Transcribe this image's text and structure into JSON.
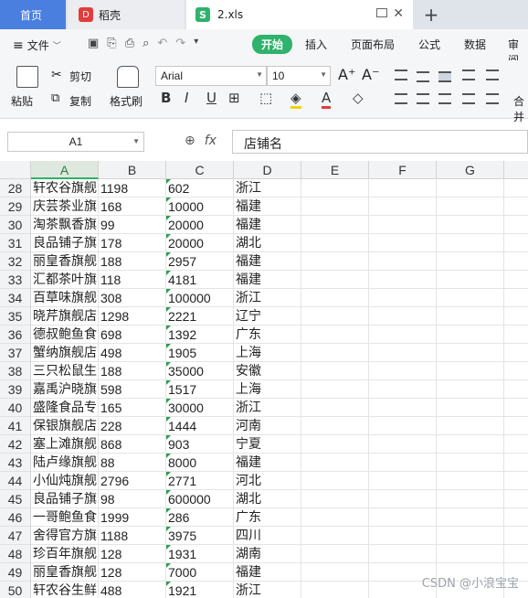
{
  "tabs": {
    "home": "首页",
    "doc": "稻壳",
    "file": "2.xls"
  },
  "menu": {
    "file": "文件",
    "items": [
      "开始",
      "插入",
      "页面布局",
      "公式",
      "数据",
      "审阅"
    ]
  },
  "ribbon": {
    "paste": "粘贴",
    "cut": "剪切",
    "copy": "复制",
    "format_painter": "格式刷",
    "font_name": "Arial",
    "font_size": "10",
    "merge": "合并"
  },
  "formula_bar": {
    "name_box": "A1",
    "content": "店铺名"
  },
  "columns": [
    "A",
    "B",
    "C",
    "D",
    "E",
    "F",
    "G"
  ],
  "rows": [
    {
      "n": "28",
      "a": "轩农谷旗舰",
      "b": "1198",
      "c": "602",
      "d": "浙江"
    },
    {
      "n": "29",
      "a": "庆芸茶业旗",
      "b": "168",
      "c": "10000",
      "d": "福建"
    },
    {
      "n": "30",
      "a": "淘茶飘香旗",
      "b": "99",
      "c": "20000",
      "d": "福建"
    },
    {
      "n": "31",
      "a": "良品铺子旗",
      "b": "178",
      "c": "20000",
      "d": "湖北"
    },
    {
      "n": "32",
      "a": "丽皇香旗舰",
      "b": "188",
      "c": "2957",
      "d": "福建"
    },
    {
      "n": "33",
      "a": "汇都茶叶旗",
      "b": "118",
      "c": "4181",
      "d": "福建"
    },
    {
      "n": "34",
      "a": "百草味旗舰",
      "b": "308",
      "c": "100000",
      "d": "浙江"
    },
    {
      "n": "35",
      "a": "晓芹旗舰店",
      "b": "1298",
      "c": "2221",
      "d": "辽宁"
    },
    {
      "n": "36",
      "a": "德叔鲍鱼食",
      "b": "698",
      "c": "1392",
      "d": "广东"
    },
    {
      "n": "37",
      "a": "蟹纳旗舰店",
      "b": "498",
      "c": "1905",
      "d": "上海"
    },
    {
      "n": "38",
      "a": "三只松鼠生",
      "b": "188",
      "c": "35000",
      "d": "安徽"
    },
    {
      "n": "39",
      "a": "嘉禹沪晓旗",
      "b": "598",
      "c": "1517",
      "d": "上海"
    },
    {
      "n": "40",
      "a": "盛隆食品专",
      "b": "165",
      "c": "30000",
      "d": "浙江"
    },
    {
      "n": "41",
      "a": "保银旗舰店",
      "b": "228",
      "c": "1444",
      "d": "河南"
    },
    {
      "n": "42",
      "a": "塞上滩旗舰",
      "b": "868",
      "c": "903",
      "d": "宁夏"
    },
    {
      "n": "43",
      "a": "陆卢缘旗舰",
      "b": "88",
      "c": "8000",
      "d": "福建"
    },
    {
      "n": "44",
      "a": "小仙炖旗舰",
      "b": "2796",
      "c": "2771",
      "d": "河北"
    },
    {
      "n": "45",
      "a": "良品铺子旗",
      "b": "98",
      "c": "600000",
      "d": "湖北"
    },
    {
      "n": "46",
      "a": "一哥鲍鱼食",
      "b": "1999",
      "c": "286",
      "d": "广东"
    },
    {
      "n": "47",
      "a": "舍得官方旗",
      "b": "1188",
      "c": "3975",
      "d": "四川"
    },
    {
      "n": "48",
      "a": "珍百年旗舰",
      "b": "128",
      "c": "1931",
      "d": "湖南"
    },
    {
      "n": "49",
      "a": "丽皇香旗舰",
      "b": "128",
      "c": "7000",
      "d": "福建"
    },
    {
      "n": "50",
      "a": "轩农谷生鲜",
      "b": "488",
      "c": "1921",
      "d": "浙江"
    }
  ],
  "watermark": "CSDN @小浪宝宝",
  "colors": {
    "accent": "#2fb26b",
    "home_tab": "#4a7fe0"
  }
}
